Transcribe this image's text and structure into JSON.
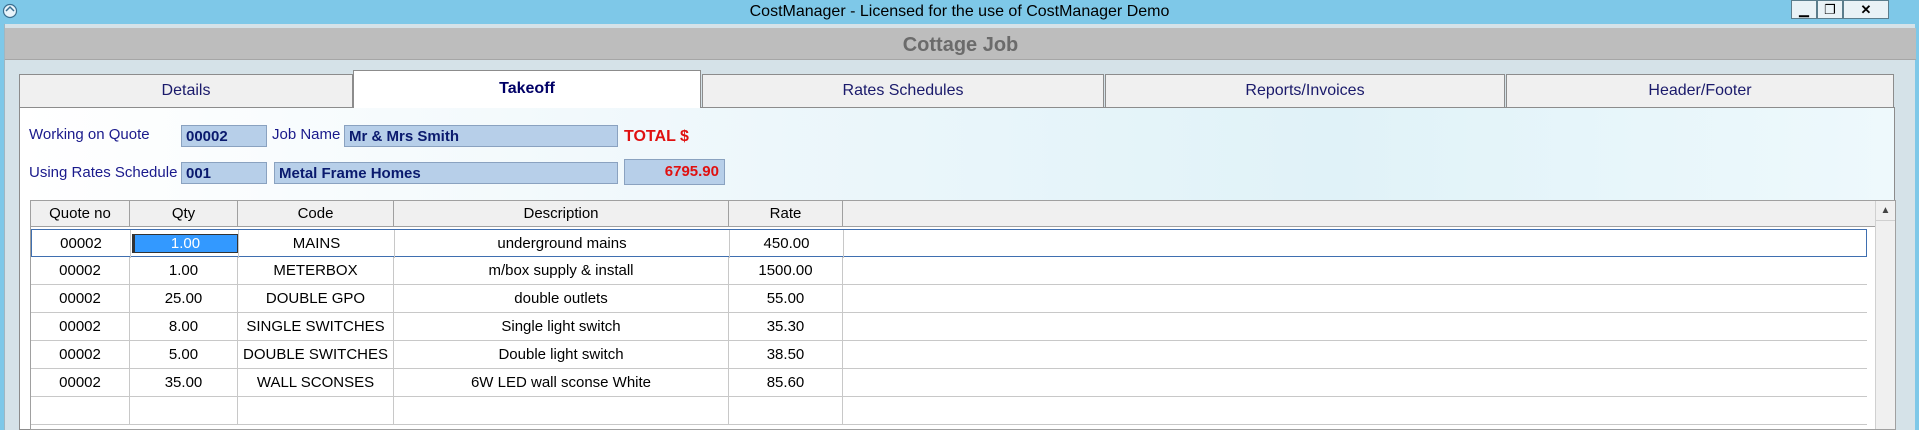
{
  "window": {
    "title": "CostManager - Licensed for the use of CostManager Demo",
    "minimize_glyph": "▁",
    "restore_glyph": "❐",
    "close_glyph": "✕"
  },
  "job": {
    "title": "Cottage Job"
  },
  "tabs": [
    {
      "label": "Details",
      "active": false
    },
    {
      "label": "Takeoff",
      "active": true
    },
    {
      "label": "Rates Schedules",
      "active": false
    },
    {
      "label": "Reports/Invoices",
      "active": false
    },
    {
      "label": "Header/Footer",
      "active": false
    }
  ],
  "form": {
    "quote_label": "Working on Quote",
    "quote_value": "00002",
    "jobname_label": "Job Name",
    "jobname_value": "Mr & Mrs Smith",
    "total_label": "TOTAL $",
    "rates_label": "Using Rates Schedule",
    "rates_code": "001",
    "rates_name": "Metal Frame Homes",
    "total_value": "6795.90"
  },
  "grid": {
    "columns": [
      "Quote no",
      "Qty",
      "Code",
      "Description",
      "Rate"
    ],
    "rows": [
      [
        "00002",
        "1.00",
        "MAINS",
        "underground mains",
        "450.00"
      ],
      [
        "00002",
        "1.00",
        "METERBOX",
        "m/box supply & install",
        "1500.00"
      ],
      [
        "00002",
        "25.00",
        "DOUBLE GPO",
        "double outlets",
        "55.00"
      ],
      [
        "00002",
        "8.00",
        "SINGLE SWITCHES",
        "Single light switch",
        "35.30"
      ],
      [
        "00002",
        "5.00",
        "DOUBLE SWITCHES",
        "Double light switch",
        "38.50"
      ],
      [
        "00002",
        "35.00",
        "WALL SCONSES",
        "6W LED wall sconse White",
        "85.60"
      ],
      [
        "",
        "",
        "",
        "",
        ""
      ]
    ]
  },
  "colors": {
    "titlebar": "#7ec8e8",
    "total_red": "#e01010",
    "field_blue": "#b7cfe9"
  }
}
